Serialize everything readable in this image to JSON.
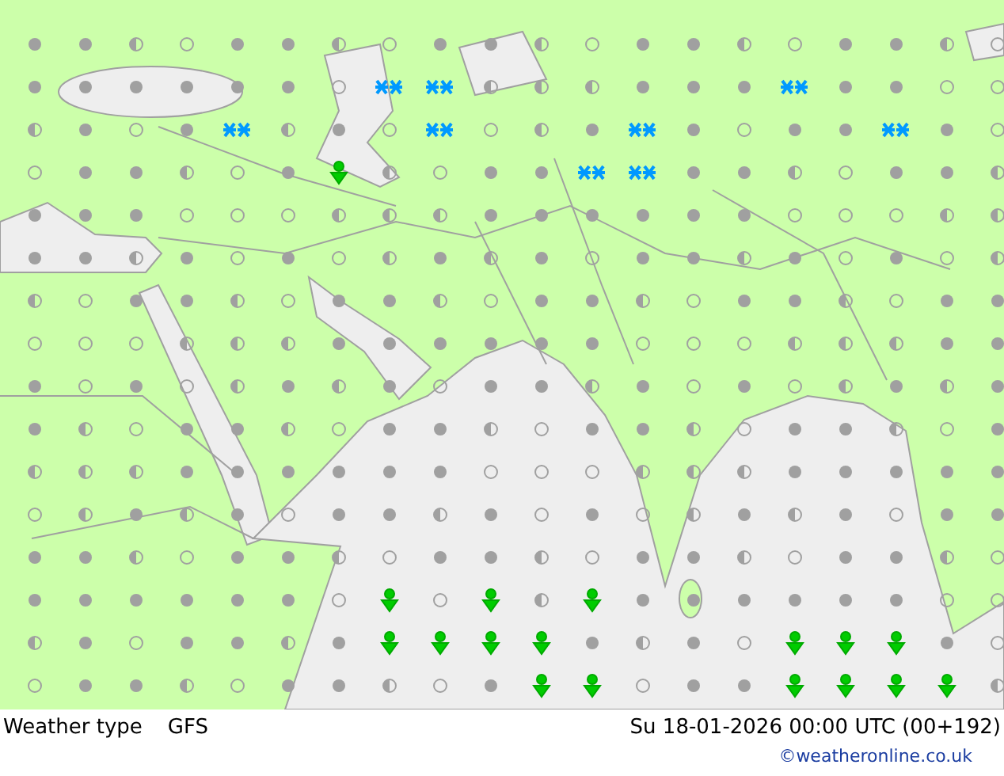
{
  "footer": {
    "title": "Weather type",
    "model": "GFS",
    "datetime": "Su 18-01-2026 00:00 UTC (00+192)",
    "credit": "©weatheronline.co.uk"
  }
}
